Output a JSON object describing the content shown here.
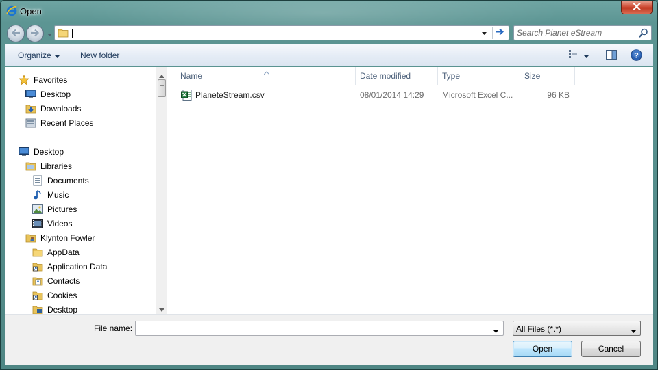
{
  "window": {
    "title": "Open"
  },
  "address": {
    "path": ""
  },
  "search": {
    "placeholder": "Search Planet eStream"
  },
  "toolbar": {
    "organize_label": "Organize",
    "new_folder_label": "New folder"
  },
  "nav_tree": {
    "favorites": [
      {
        "label": "Favorites",
        "icon": "star-icon"
      },
      {
        "label": "Desktop",
        "icon": "desktop-icon"
      },
      {
        "label": "Downloads",
        "icon": "downloads-icon"
      },
      {
        "label": "Recent Places",
        "icon": "recent-places-icon"
      }
    ],
    "desktop_tree": [
      {
        "label": "Desktop",
        "icon": "desktop-icon"
      },
      {
        "label": "Libraries",
        "icon": "libraries-icon"
      },
      {
        "label": "Documents",
        "icon": "documents-icon"
      },
      {
        "label": "Music",
        "icon": "music-icon"
      },
      {
        "label": "Pictures",
        "icon": "pictures-icon"
      },
      {
        "label": "Videos",
        "icon": "videos-icon"
      },
      {
        "label": "Klynton Fowler",
        "icon": "user-folder-icon"
      },
      {
        "label": "AppData",
        "icon": "folder-icon"
      },
      {
        "label": "Application Data",
        "icon": "shortcut-folder-icon"
      },
      {
        "label": "Contacts",
        "icon": "contacts-icon"
      },
      {
        "label": "Cookies",
        "icon": "shortcut-folder-icon"
      },
      {
        "label": "Desktop",
        "icon": "desktop-folder-icon"
      }
    ]
  },
  "file_list": {
    "columns": [
      "Name",
      "Date modified",
      "Type",
      "Size"
    ],
    "rows": [
      {
        "name": "PlaneteStream.csv",
        "date_modified": "08/01/2014 14:29",
        "type": "Microsoft Excel C...",
        "size": "96 KB",
        "icon": "excel-csv-icon"
      }
    ]
  },
  "bottom": {
    "file_name_label": "File name:",
    "file_name_value": "",
    "filter_value": "All Files (*.*)",
    "open_label": "Open",
    "cancel_label": "Cancel"
  },
  "colors": {
    "frame": "#5c9593",
    "toolbar_text": "#1e395b",
    "header_text": "#4c607a",
    "open_button_border": "#3c7fb1"
  }
}
